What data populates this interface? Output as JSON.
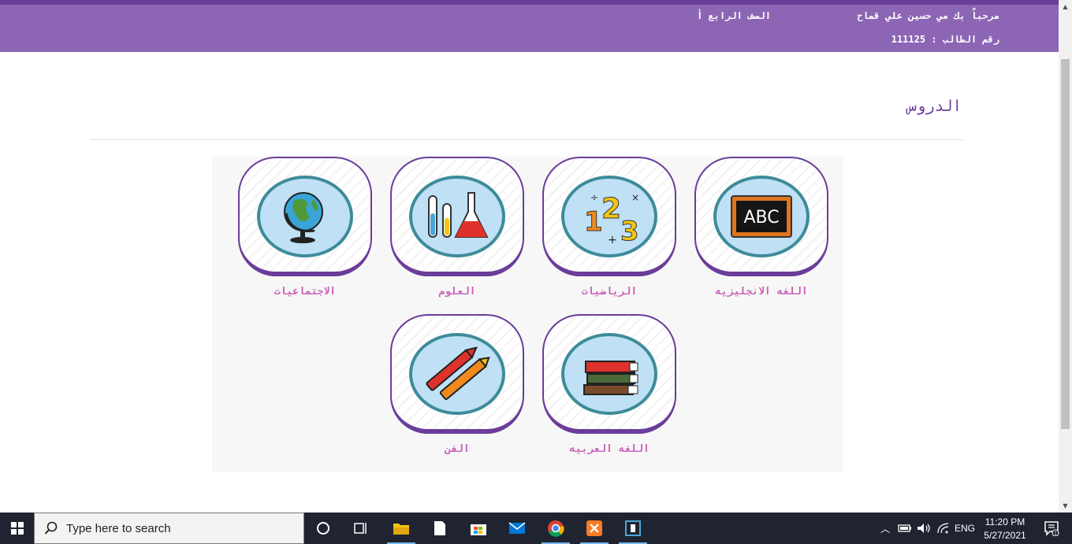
{
  "header": {
    "welcome": "مرحباً بك مي حسين علي قماح",
    "grade": "الصف الرابع أ",
    "student_id": "رقم الطالب : 111125"
  },
  "lessons": {
    "title": "الدروس",
    "subjects": [
      {
        "label": "اللغه الانجليزيه",
        "icon": "chalkboard-abc-icon"
      },
      {
        "label": "الرياضيات",
        "icon": "numbers-123-icon"
      },
      {
        "label": "العلوم",
        "icon": "lab-flasks-icon"
      },
      {
        "label": "الاجتماعيات",
        "icon": "globe-icon"
      },
      {
        "label": "اللغه العربيه",
        "icon": "books-stack-icon"
      },
      {
        "label": "الفن",
        "icon": "crayons-icon"
      }
    ],
    "icon_texts": {
      "abc": "ABC",
      "n1": "1",
      "n2": "2",
      "n3": "3"
    }
  },
  "taskbar": {
    "search_placeholder": "Type here to search",
    "language": "ENG",
    "time": "11:20 PM",
    "date": "5/27/2021",
    "notification_count": "1"
  },
  "colors": {
    "header_bg": "#8c66b5",
    "accent": "#6a3d9a",
    "label": "#c95fb7"
  }
}
